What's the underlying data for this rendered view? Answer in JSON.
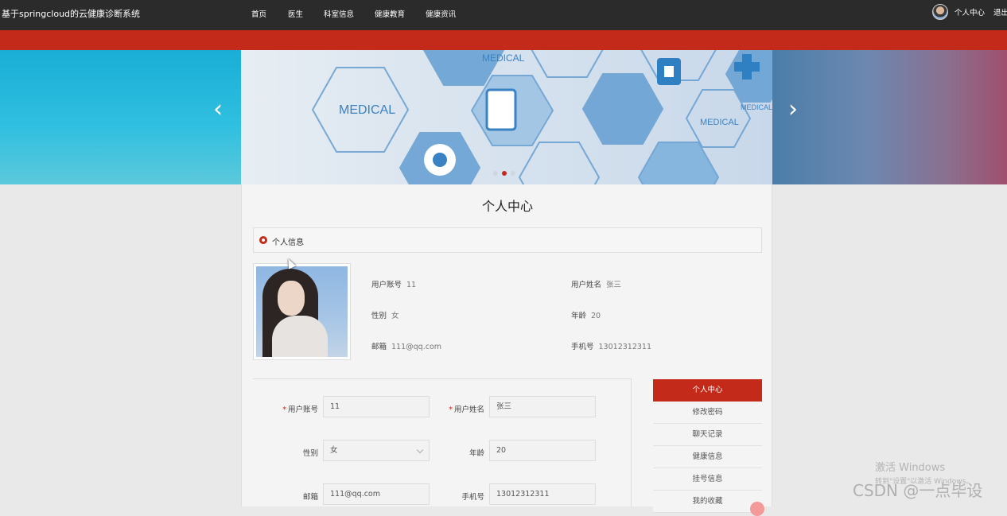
{
  "header": {
    "brand": "基于springcloud的云健康诊断系统",
    "nav": [
      "首页",
      "医生",
      "科室信息",
      "健康教育",
      "健康资讯"
    ],
    "user_center": "个人中心",
    "logout": "退出"
  },
  "banner": {
    "left_arrow": "‹",
    "right_arrow": "›",
    "active_dot": 1,
    "dot_count": 3,
    "image_text": [
      "MEDICAL",
      "MEDICAL",
      "MEDICAL",
      "MEDICAL"
    ]
  },
  "page": {
    "title": "个人中心",
    "section_title": "个人信息"
  },
  "profile": {
    "account_label": "用户账号",
    "account_value": "11",
    "name_label": "用户姓名",
    "name_value": "张三",
    "gender_label": "性别",
    "gender_value": "女",
    "age_label": "年龄",
    "age_value": "20",
    "email_label": "邮箱",
    "email_value": "111@qq.com",
    "phone_label": "手机号",
    "phone_value": "13012312311"
  },
  "form": {
    "account_label": "用户账号",
    "account_value": "11",
    "name_label": "用户姓名",
    "name_value": "张三",
    "gender_label": "性别",
    "gender_value": "女",
    "age_label": "年龄",
    "age_value": "20",
    "email_label": "邮箱",
    "email_value": "111@qq.com",
    "phone_label": "手机号",
    "phone_value": "13012312311"
  },
  "side_menu": [
    "个人中心",
    "修改密码",
    "聊天记录",
    "健康信息",
    "挂号信息",
    "我的收藏"
  ],
  "watermark": {
    "line1": "激活 Windows",
    "line2": "转到\"设置\"以激活 Windows。",
    "csdn": "CSDN @一点毕设"
  },
  "colors": {
    "accent": "#c42a1a",
    "topbar": "#2b2b2b"
  }
}
